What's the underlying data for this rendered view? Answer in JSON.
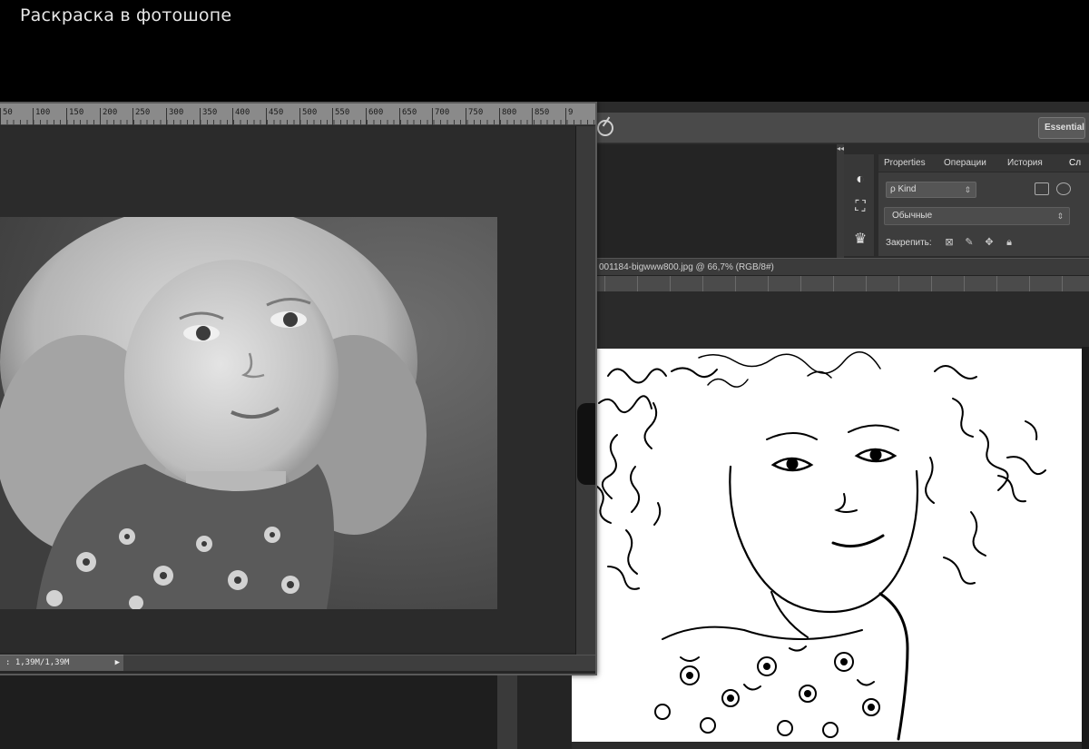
{
  "page": {
    "title": "Раскраска в фотошопе"
  },
  "left_window": {
    "ruler_ticks": [
      "50",
      "100",
      "150",
      "200",
      "250",
      "300",
      "350",
      "400",
      "450",
      "500",
      "550",
      "600",
      "650",
      "700",
      "750",
      "800",
      "850",
      "9"
    ],
    "status_text": ": 1,39M/1,39M",
    "status_arrow": "▶",
    "photo_subject": "grayscale-photo-of-curly-haired-girl"
  },
  "right_window": {
    "essentials_label": "Essentials",
    "panel_tabs": [
      "Properties",
      "Операции",
      "История",
      "Сл"
    ],
    "kind_label": "ρ Kind",
    "blend_mode": "Обычные",
    "locks_label": "Закрепить:",
    "document_tab": "001184-bigwww800.jpg @ 66,7% (RGB/8#)",
    "image_subject": "black-and-white-line-sketch-of-girl"
  },
  "colors": {
    "ui_dark": "#2b2b2b",
    "panel": "#3d3d3d",
    "ruler": "#8a8a8a",
    "sketch_bg": "#ffffff"
  }
}
